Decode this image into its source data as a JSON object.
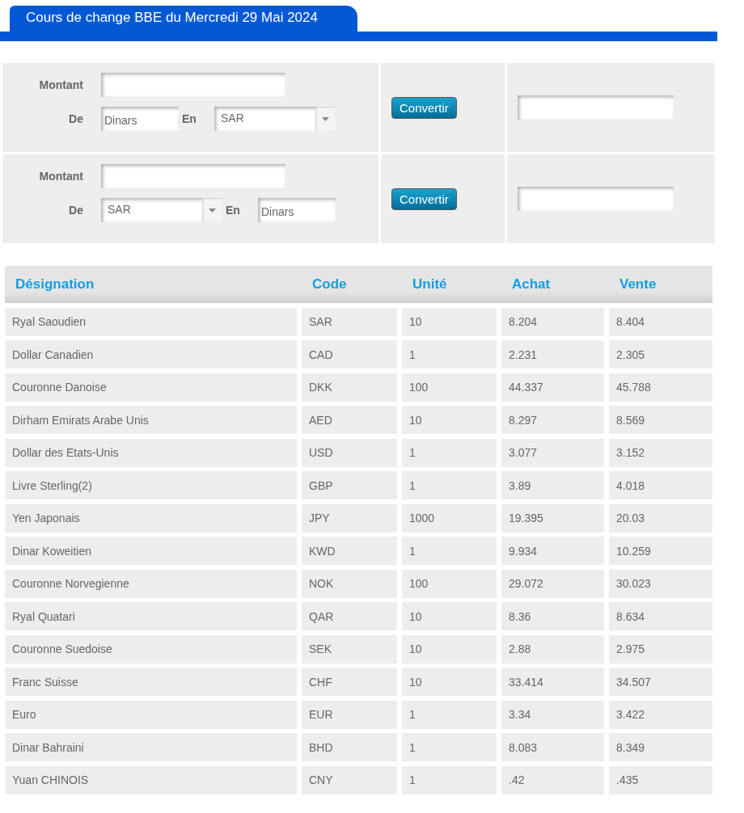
{
  "title": "Cours de change BBE du Mercredi 29 Mai 2024",
  "converters": [
    {
      "amount_label": "Montant",
      "from_label": "De",
      "to_label": "En",
      "from": {
        "kind": "text",
        "value": "Dinars"
      },
      "to": {
        "kind": "select",
        "value": "SAR"
      },
      "button": "Convertir"
    },
    {
      "amount_label": "Montant",
      "from_label": "De",
      "to_label": "En",
      "from": {
        "kind": "select",
        "value": "SAR"
      },
      "to": {
        "kind": "text",
        "value": "Dinars"
      },
      "button": "Convertir"
    }
  ],
  "table": {
    "columns": [
      "Désignation",
      "Code",
      "Unité",
      "Achat",
      "Vente"
    ],
    "rows": [
      [
        "Ryal Saoudien",
        "SAR",
        "10",
        "8.204",
        "8.404"
      ],
      [
        "Dollar Canadien",
        "CAD",
        "1",
        "2.231",
        "2.305"
      ],
      [
        "Couronne Danoise",
        "DKK",
        "100",
        "44.337",
        "45.788"
      ],
      [
        "Dirham Emirats Arabe Unis",
        "AED",
        "10",
        "8.297",
        "8.569"
      ],
      [
        "Dollar des Etats-Unis",
        "USD",
        "1",
        "3.077",
        "3.152"
      ],
      [
        "Livre Sterling(2)",
        "GBP",
        "1",
        "3.89",
        "4.018"
      ],
      [
        "Yen Japonais",
        "JPY",
        "1000",
        "19.395",
        "20.03"
      ],
      [
        "Dinar Koweitien",
        "KWD",
        "1",
        "9.934",
        "10.259"
      ],
      [
        "Couronne Norvegienne",
        "NOK",
        "100",
        "29.072",
        "30.023"
      ],
      [
        "Ryal Quatari",
        "QAR",
        "10",
        "8.36",
        "8.634"
      ],
      [
        "Couronne Suedoise",
        "SEK",
        "10",
        "2.88",
        "2.975"
      ],
      [
        "Franc Suisse",
        "CHF",
        "10",
        "33.414",
        "34.507"
      ],
      [
        "Euro",
        "EUR",
        "1",
        "3.34",
        "3.422"
      ],
      [
        "Dinar Bahraini",
        "BHD",
        "1",
        "8.083",
        "8.349"
      ],
      [
        "Yuan CHINOIS",
        "CNY",
        "1",
        ".42",
        ".435"
      ]
    ]
  }
}
